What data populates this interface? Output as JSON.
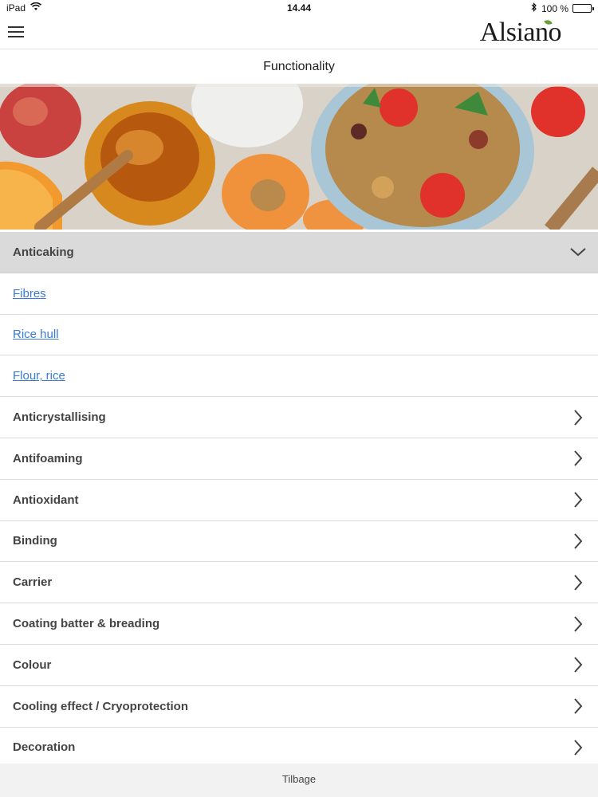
{
  "status": {
    "device": "iPad",
    "time": "14.44",
    "battery": "100 %",
    "battery_level": 1.0
  },
  "header": {
    "logo": "Alsiano",
    "menu_icon": "hamburger-icon"
  },
  "page": {
    "title": "Functionality"
  },
  "accordion": {
    "open_section": {
      "label": "Anticaking",
      "icon": "chevron-down-icon",
      "items": [
        "Fibres",
        "Rice hull",
        "Flour, rice"
      ]
    },
    "collapsed_sections": [
      "Anticrystallising",
      "Antifoaming",
      "Antioxidant",
      "Binding",
      "Carrier",
      "Coating batter & breading",
      "Colour",
      "Cooling effect / Cryoprotection",
      "Decoration"
    ],
    "collapsed_icon": "chevron-right-icon"
  },
  "footer": {
    "back_label": "Tilbage"
  },
  "colors": {
    "link": "#3a7bd5",
    "open_header_bg": "#dadada",
    "logo_leaf": "#6a9e3a"
  }
}
